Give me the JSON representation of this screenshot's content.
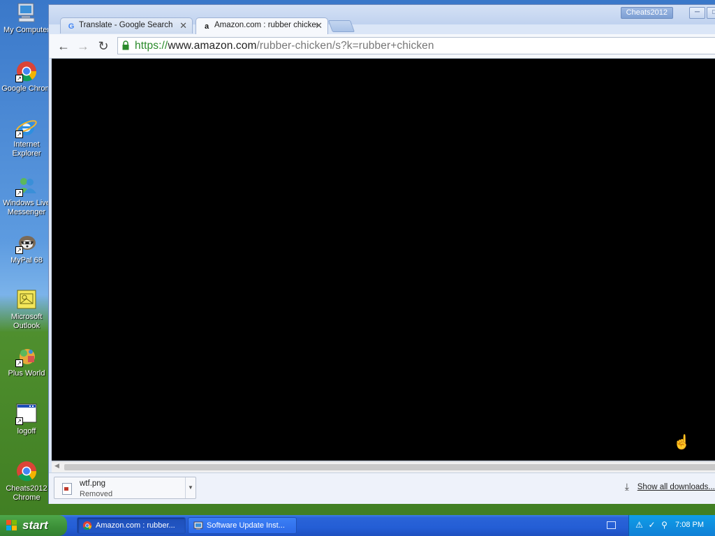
{
  "desktop": {
    "icons": [
      {
        "label": "My Computer",
        "icon": "my-computer-icon"
      },
      {
        "label": "Google Chrom",
        "icon": "chrome-icon"
      },
      {
        "label": "Internet Explorer",
        "icon": "internet-explorer-icon"
      },
      {
        "label": "Windows Live Messenger",
        "icon": "messenger-icon"
      },
      {
        "label": "MyPal 68",
        "icon": "mypal-icon"
      },
      {
        "label": "Microsoft Outlook",
        "icon": "outlook-icon"
      },
      {
        "label": "Plus World",
        "icon": "plus-world-icon"
      },
      {
        "label": "logoff",
        "icon": "logoff-icon"
      },
      {
        "label": "Cheats2012 Chrome",
        "icon": "chrome-icon"
      }
    ]
  },
  "browser": {
    "profile_name": "Cheats2012",
    "tabs": [
      {
        "title": "Translate - Google Search",
        "favicon": "google-icon",
        "active": false
      },
      {
        "title": "Amazon.com : rubber chicken",
        "favicon": "amazon-icon",
        "active": true
      }
    ],
    "url": {
      "scheme": "https://",
      "host": "www.amazon.com",
      "path": "/rubber-chicken/s?k=rubber+chicken"
    },
    "downloads": {
      "item": {
        "name": "wtf.png",
        "status": "Removed"
      },
      "show_all_label": "Show all downloads..."
    }
  },
  "taskbar": {
    "start_label": "start",
    "buttons": [
      {
        "label": "Amazon.com : rubber...",
        "icon": "chrome-icon",
        "active": true
      },
      {
        "label": "Software Update Inst...",
        "icon": "installer-icon",
        "active": false
      }
    ],
    "clock": "7:08 PM"
  },
  "colors": {
    "taskbar_blue": "#245ed5",
    "start_green": "#3b8f37",
    "tray_blue": "#0f9ee8",
    "secure_green": "#2a8a2a",
    "page_content": "#000000"
  }
}
